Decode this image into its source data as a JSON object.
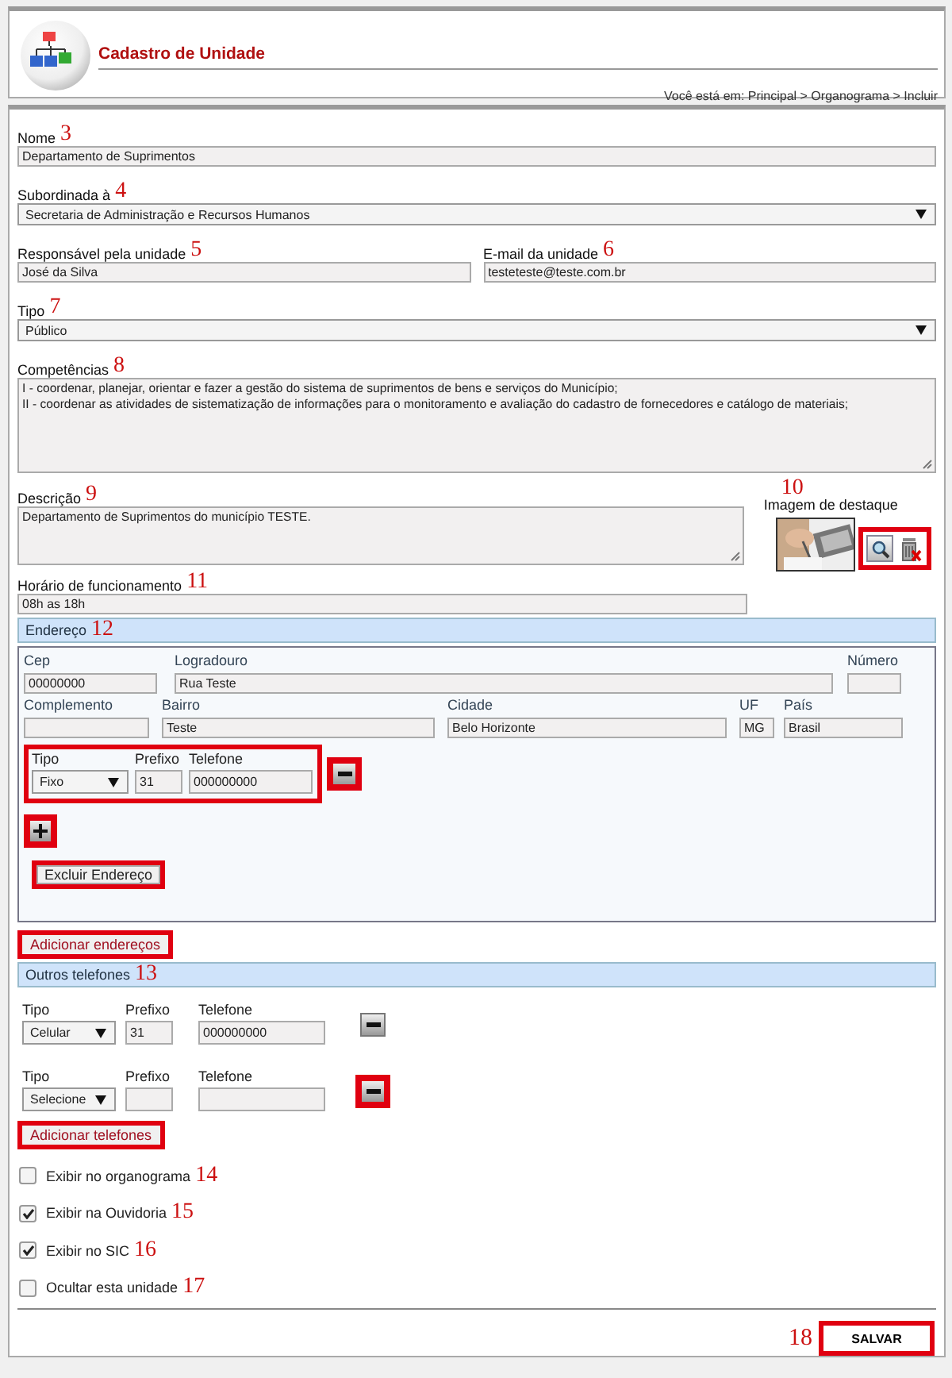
{
  "header": {
    "title": "Cadastro de Unidade",
    "breadcrumb": "Você está em: Principal > Organograma > Incluir"
  },
  "nome": {
    "label": "Nome",
    "marker": "3",
    "value": "Departamento de Suprimentos"
  },
  "subordinada": {
    "label": "Subordinada à",
    "marker": "4",
    "value": "Secretaria de Administração e Recursos Humanos"
  },
  "responsavel": {
    "label": "Responsável pela unidade",
    "marker": "5",
    "value": "José da Silva"
  },
  "email": {
    "label": "E-mail da unidade",
    "marker": "6",
    "value": "testeteste@teste.com.br"
  },
  "tipo": {
    "label": "Tipo",
    "marker": "7",
    "value": "Público"
  },
  "competencias": {
    "label": "Competências",
    "marker": "8",
    "lines": [
      "I - coordenar, planejar, orientar e fazer a gestão do sistema de suprimentos de bens e serviços do Município;",
      "II - coordenar as atividades de sistematização de informações para o monitoramento e avaliação do cadastro de fornecedores e catálogo de materiais;"
    ]
  },
  "descricao": {
    "label": "Descrição",
    "marker": "9",
    "value": "Departamento de Suprimentos do município TESTE."
  },
  "imagem": {
    "label": "Imagem de destaque",
    "marker": "10",
    "actions_highlighted": true
  },
  "horario": {
    "label": "Horário de funcionamento",
    "marker": "11",
    "value": "08h as 18h"
  },
  "endereco": {
    "title": "Endereço",
    "marker": "12",
    "rows": [
      [
        {
          "label": "Cep",
          "value": "00000000"
        },
        {
          "label": "Logradouro",
          "value": "Rua Teste"
        },
        {
          "label": "Número"
        }
      ],
      [
        {
          "label": "Complemento"
        },
        {
          "label": "Bairro",
          "value": "Teste"
        },
        {
          "label": "Cidade",
          "value": "Belo Horizonte"
        },
        {
          "label": "UF",
          "value": "MG"
        },
        {
          "label": "País",
          "value": "Brasil"
        }
      ]
    ],
    "phone": {
      "highlighted": true,
      "type_label": "Tipo",
      "type": "Fixo",
      "prefix_label": "Prefixo",
      "prefix": "31",
      "number_label": "Telefone",
      "number": "000000000",
      "remove_highlighted": true
    },
    "add_phone_highlighted": true,
    "delete": {
      "label": "Excluir Endereço",
      "highlighted": true
    }
  },
  "add_address": {
    "label": "Adicionar endereços",
    "highlighted": true
  },
  "outros": {
    "title": "Outros telefones",
    "marker": "13",
    "phones": [
      {
        "type_label": "Tipo",
        "type": "Celular",
        "prefix_label": "Prefixo",
        "prefix": "31",
        "number_label": "Telefone",
        "number": "000000000",
        "remove_highlighted": false
      },
      {
        "type_label": "Tipo",
        "type": "Selecione",
        "prefix_label": "Prefixo",
        "number_label": "Telefone",
        "remove_highlighted": true
      }
    ]
  },
  "add_phones": {
    "label": "Adicionar telefones",
    "highlighted": true
  },
  "options": [
    {
      "label": "Exibir no organograma",
      "marker": "14",
      "checked": false
    },
    {
      "label": "Exibir na Ouvidoria",
      "marker": "15",
      "checked": true
    },
    {
      "label": "Exibir no SIC",
      "marker": "16",
      "checked": true
    },
    {
      "label": "Ocultar esta unidade",
      "marker": "17",
      "checked": false
    }
  ],
  "save": {
    "label": "SALVAR",
    "marker": "18",
    "highlighted": true
  }
}
